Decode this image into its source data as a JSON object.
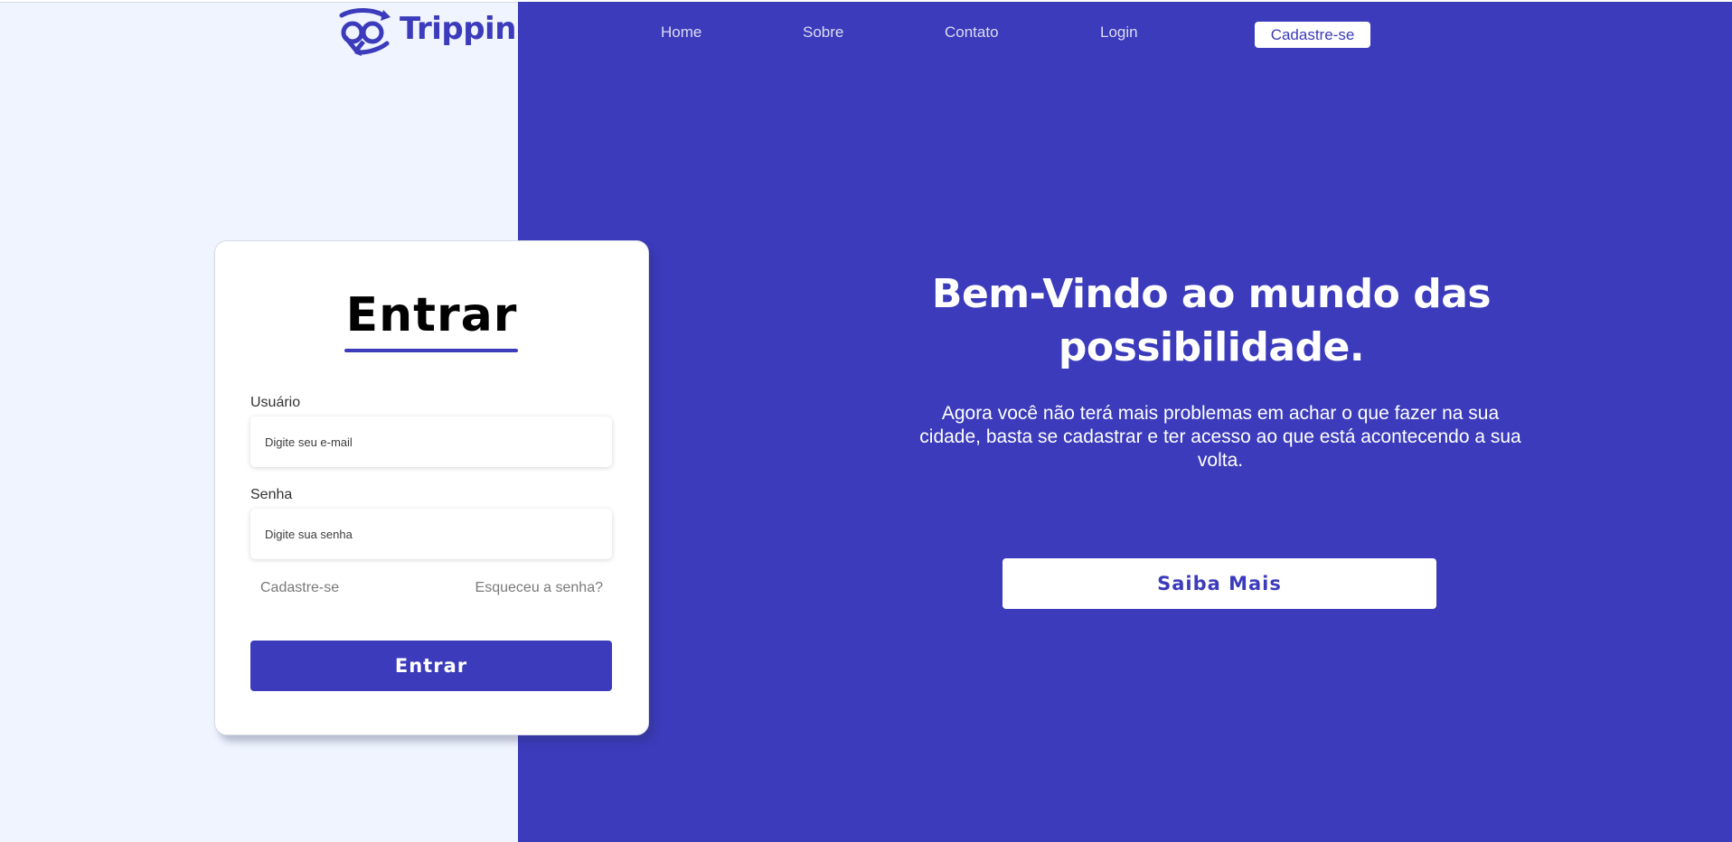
{
  "brand": {
    "name": "Trippin",
    "icon": "binoculars-arrows-icon",
    "color": "#3b3bbb"
  },
  "nav": {
    "items": [
      {
        "label": "Home"
      },
      {
        "label": "Sobre"
      },
      {
        "label": "Contato"
      },
      {
        "label": "Login"
      }
    ],
    "cta_label": "Cadastre-se"
  },
  "login": {
    "title": "Entrar",
    "username_label": "Usuário",
    "username_placeholder": "Digite seu e-mail",
    "username_value": "",
    "password_label": "Senha",
    "password_placeholder": "Digite sua senha",
    "password_value": "",
    "signup_link": "Cadastre-se",
    "forgot_link": "Esqueceu a senha?",
    "submit_label": "Entrar"
  },
  "hero": {
    "title": "Bem-Vindo ao mundo das possibilidade.",
    "subtitle": "Agora você não terá mais problemas em achar o que fazer na sua cidade, basta se cadastrar e ter acesso ao que está acontecendo a sua volta.",
    "button_label": "Saiba Mais"
  },
  "colors": {
    "primary": "#3b3bbb",
    "left_background": "#eff4fe",
    "white": "#ffffff"
  }
}
